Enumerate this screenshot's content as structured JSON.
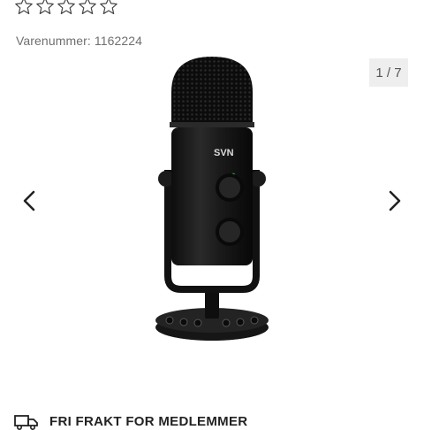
{
  "rating": {
    "stars": 5,
    "filled": 0
  },
  "product": {
    "sku_text": "Varenummer: 1162224",
    "image_label": "SVN"
  },
  "gallery": {
    "counter": "1 / 7",
    "prev_icon": "chevron-left-icon",
    "next_icon": "chevron-right-icon"
  },
  "shipping": {
    "icon": "truck-icon",
    "text": "FRI FRAKT FOR MEDLEMMER"
  },
  "colors": {
    "text": "#222222",
    "muted": "#6f6f6f",
    "counter_bg": "#eeeeee",
    "led": "#35d04f"
  }
}
